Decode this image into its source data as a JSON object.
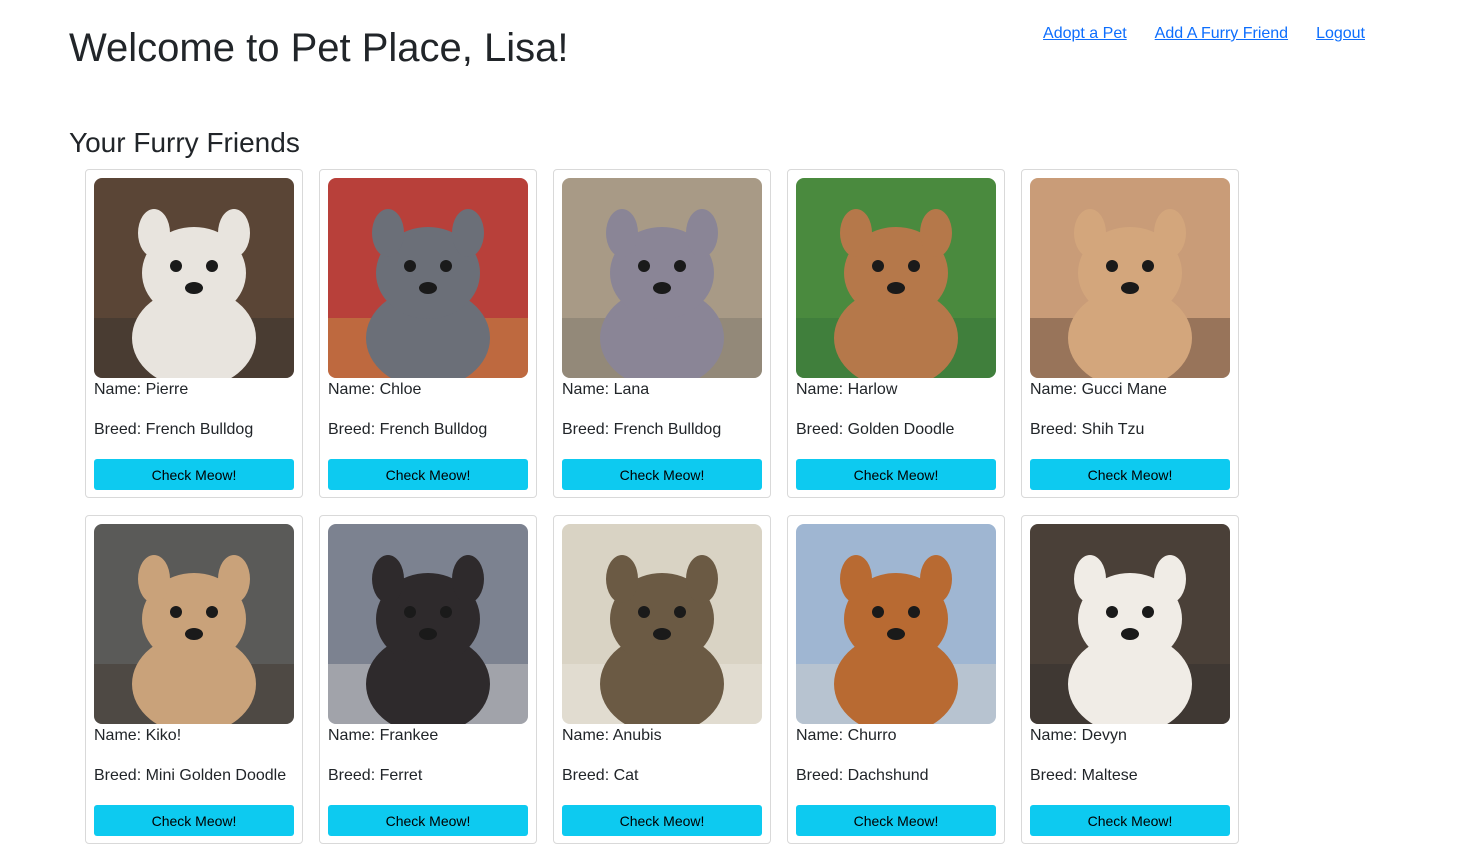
{
  "header": {
    "title": "Welcome to Pet Place, Lisa!",
    "nav": {
      "adopt": "Adopt a Pet",
      "add": "Add A Furry Friend",
      "logout": "Logout"
    }
  },
  "main": {
    "section_title": "Your Furry Friends",
    "name_prefix": "Name: ",
    "breed_prefix": "Breed: ",
    "button_label": "Check Meow!",
    "pets": [
      {
        "name": "Pierre",
        "breed": "French Bulldog",
        "icon": "french-bulldog-photo",
        "bg": "#5a4536",
        "fur": "#e8e4de",
        "accent": "#2b2b2b"
      },
      {
        "name": "Chloe",
        "breed": "French Bulldog",
        "icon": "french-bulldog-photo",
        "bg": "#b8403a",
        "fur": "#6b6f78",
        "accent": "#c8b64a"
      },
      {
        "name": "Lana",
        "breed": "French Bulldog",
        "icon": "french-bulldog-photo",
        "bg": "#a89a86",
        "fur": "#8a8596",
        "accent": "#6d6a60"
      },
      {
        "name": "Harlow",
        "breed": "Golden Doodle",
        "icon": "golden-doodle-photo",
        "bg": "#4a8a3e",
        "fur": "#b5784a",
        "accent": "#2f6a3a"
      },
      {
        "name": "Gucci Mane",
        "breed": "Shih Tzu",
        "icon": "shih-tzu-photo",
        "bg": "#c99c78",
        "fur": "#d3a67c",
        "accent": "#3b2b22"
      },
      {
        "name": "Kiko!",
        "breed": "Mini Golden Doodle",
        "icon": "golden-doodle-photo",
        "bg": "#5a5a58",
        "fur": "#c9a27a",
        "accent": "#3a2a20"
      },
      {
        "name": "Frankee",
        "breed": "Ferret",
        "icon": "ferret-photo",
        "bg": "#7c8290",
        "fur": "#2e2a2c",
        "accent": "#e8e2dc"
      },
      {
        "name": "Anubis",
        "breed": "Cat",
        "icon": "cat-photo",
        "bg": "#d9d3c4",
        "fur": "#6b5a44",
        "accent": "#f1eee7"
      },
      {
        "name": "Churro",
        "breed": "Dachshund",
        "icon": "dachshund-photo",
        "bg": "#9fb6d2",
        "fur": "#b86a32",
        "accent": "#e6ddcf"
      },
      {
        "name": "Devyn",
        "breed": "Maltese",
        "icon": "maltese-photo",
        "bg": "#4a4038",
        "fur": "#f0ece6",
        "accent": "#2a2a2a"
      }
    ]
  }
}
